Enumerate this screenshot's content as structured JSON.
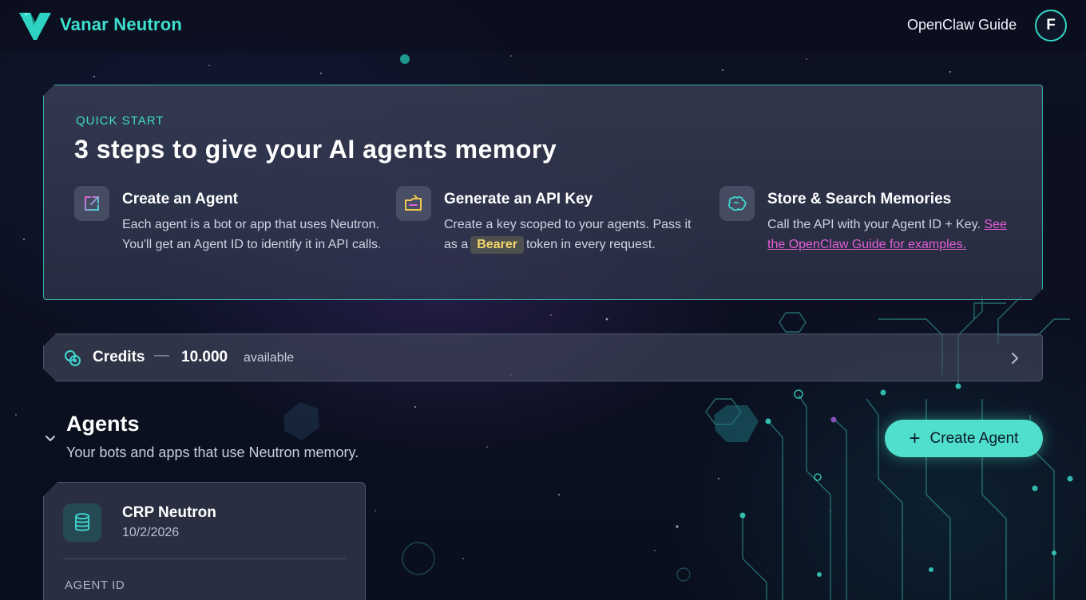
{
  "header": {
    "brand": "Vanar Neutron",
    "guide_link": "OpenClaw Guide",
    "avatar_initial": "F"
  },
  "quick_start": {
    "eyebrow": "QUICK START",
    "title": "3 steps to give your AI agents memory",
    "steps": [
      {
        "icon": "external-link-icon",
        "title": "Create an Agent",
        "description": "Each agent is a bot or app that uses Neutron. You'll get an Agent ID to identify it in API calls."
      },
      {
        "icon": "key-folder-icon",
        "title": "Generate an API Key",
        "description_before": "Create a key scoped to your agents. Pass it as a",
        "code": "Bearer",
        "description_after": "token in every request."
      },
      {
        "icon": "memory-brain-icon",
        "title": "Store & Search Memories",
        "description": "Call the API with your Agent ID + Key.",
        "link": "See the OpenClaw Guide for examples."
      }
    ]
  },
  "credits": {
    "label": "Credits",
    "separator": "—",
    "value": "10.000",
    "suffix": "available"
  },
  "agents": {
    "title": "Agents",
    "subtitle": "Your bots and apps that use Neutron memory.",
    "create_button": "Create Agent",
    "create_button_icon": "+",
    "items": [
      {
        "name": "CRP Neutron",
        "date": "10/2/2026",
        "id_label": "AGENT ID"
      }
    ]
  },
  "colors": {
    "accent": "#40dccc",
    "link": "#e35fd7",
    "badge_text": "#f4d66a",
    "background": "#0c1020"
  }
}
